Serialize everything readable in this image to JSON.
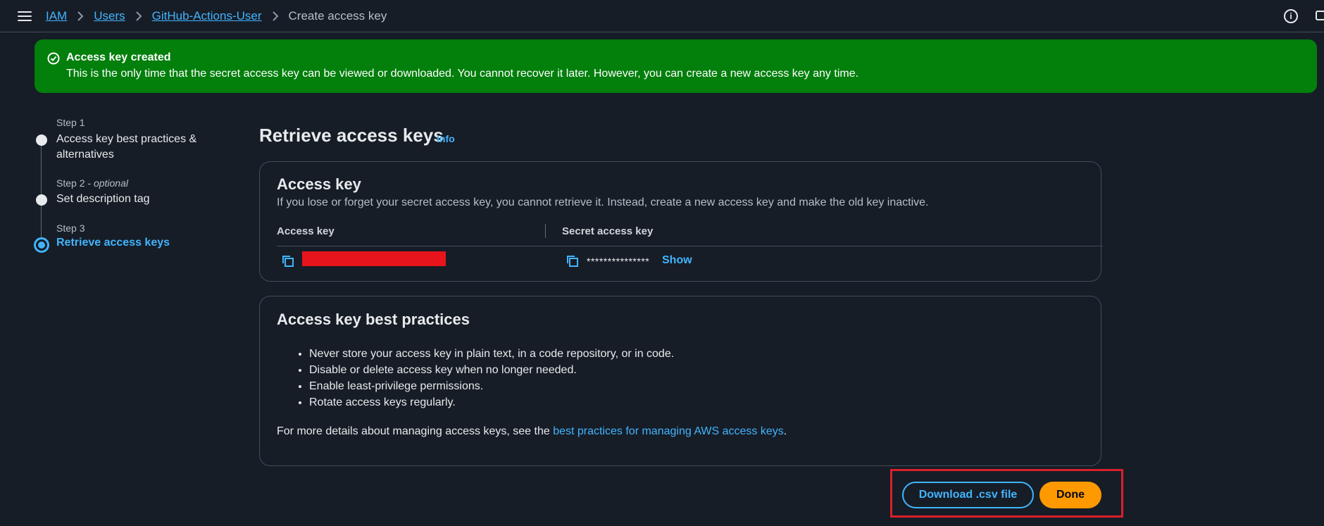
{
  "breadcrumb": {
    "items": [
      "IAM",
      "Users",
      "GitHub-Actions-User"
    ],
    "current": "Create access key"
  },
  "header": {
    "info_icon": "info-circle-icon",
    "edge_icon": "panel-icon"
  },
  "flash": {
    "title": "Access key created",
    "message": "This is the only time that the secret access key can be viewed or downloaded. You cannot recover it later. However, you can create a new access key any time.",
    "color": "#037f0c",
    "icon": "check-circle-icon"
  },
  "steps": [
    {
      "label": "Step 1",
      "title": "Access key best practices &",
      "title2": "alternatives"
    },
    {
      "label": "Step 2",
      "optional": "optional",
      "title": "Set description tag"
    },
    {
      "label": "Step 3",
      "title": "Retrieve access keys"
    }
  ],
  "page": {
    "title": "Retrieve access keys",
    "info": "Info"
  },
  "access_key_panel": {
    "title": "Access key",
    "subtitle": "If you lose or forget your secret access key, you cannot retrieve it. Instead, create a new access key and make the old key inactive.",
    "columns": [
      "Access key",
      "Secret access key"
    ],
    "secret_masked": "***************",
    "show_label": "Show"
  },
  "best_practices": {
    "title": "Access key best practices",
    "items": [
      "Never store your access key in plain text, in a code repository, or in code.",
      "Disable or delete access key when no longer needed.",
      "Enable least-privilege permissions.",
      "Rotate access keys regularly."
    ],
    "footer_prefix": "For more details about managing access keys, see the ",
    "footer_link": "best practices for managing AWS access keys",
    "footer_suffix": "."
  },
  "actions": {
    "download": "Download .csv file",
    "done": "Done"
  },
  "colors": {
    "accent": "#42b4ff",
    "primary_button": "#ff9900",
    "background": "#161d26",
    "highlight": "#d91f2a"
  }
}
